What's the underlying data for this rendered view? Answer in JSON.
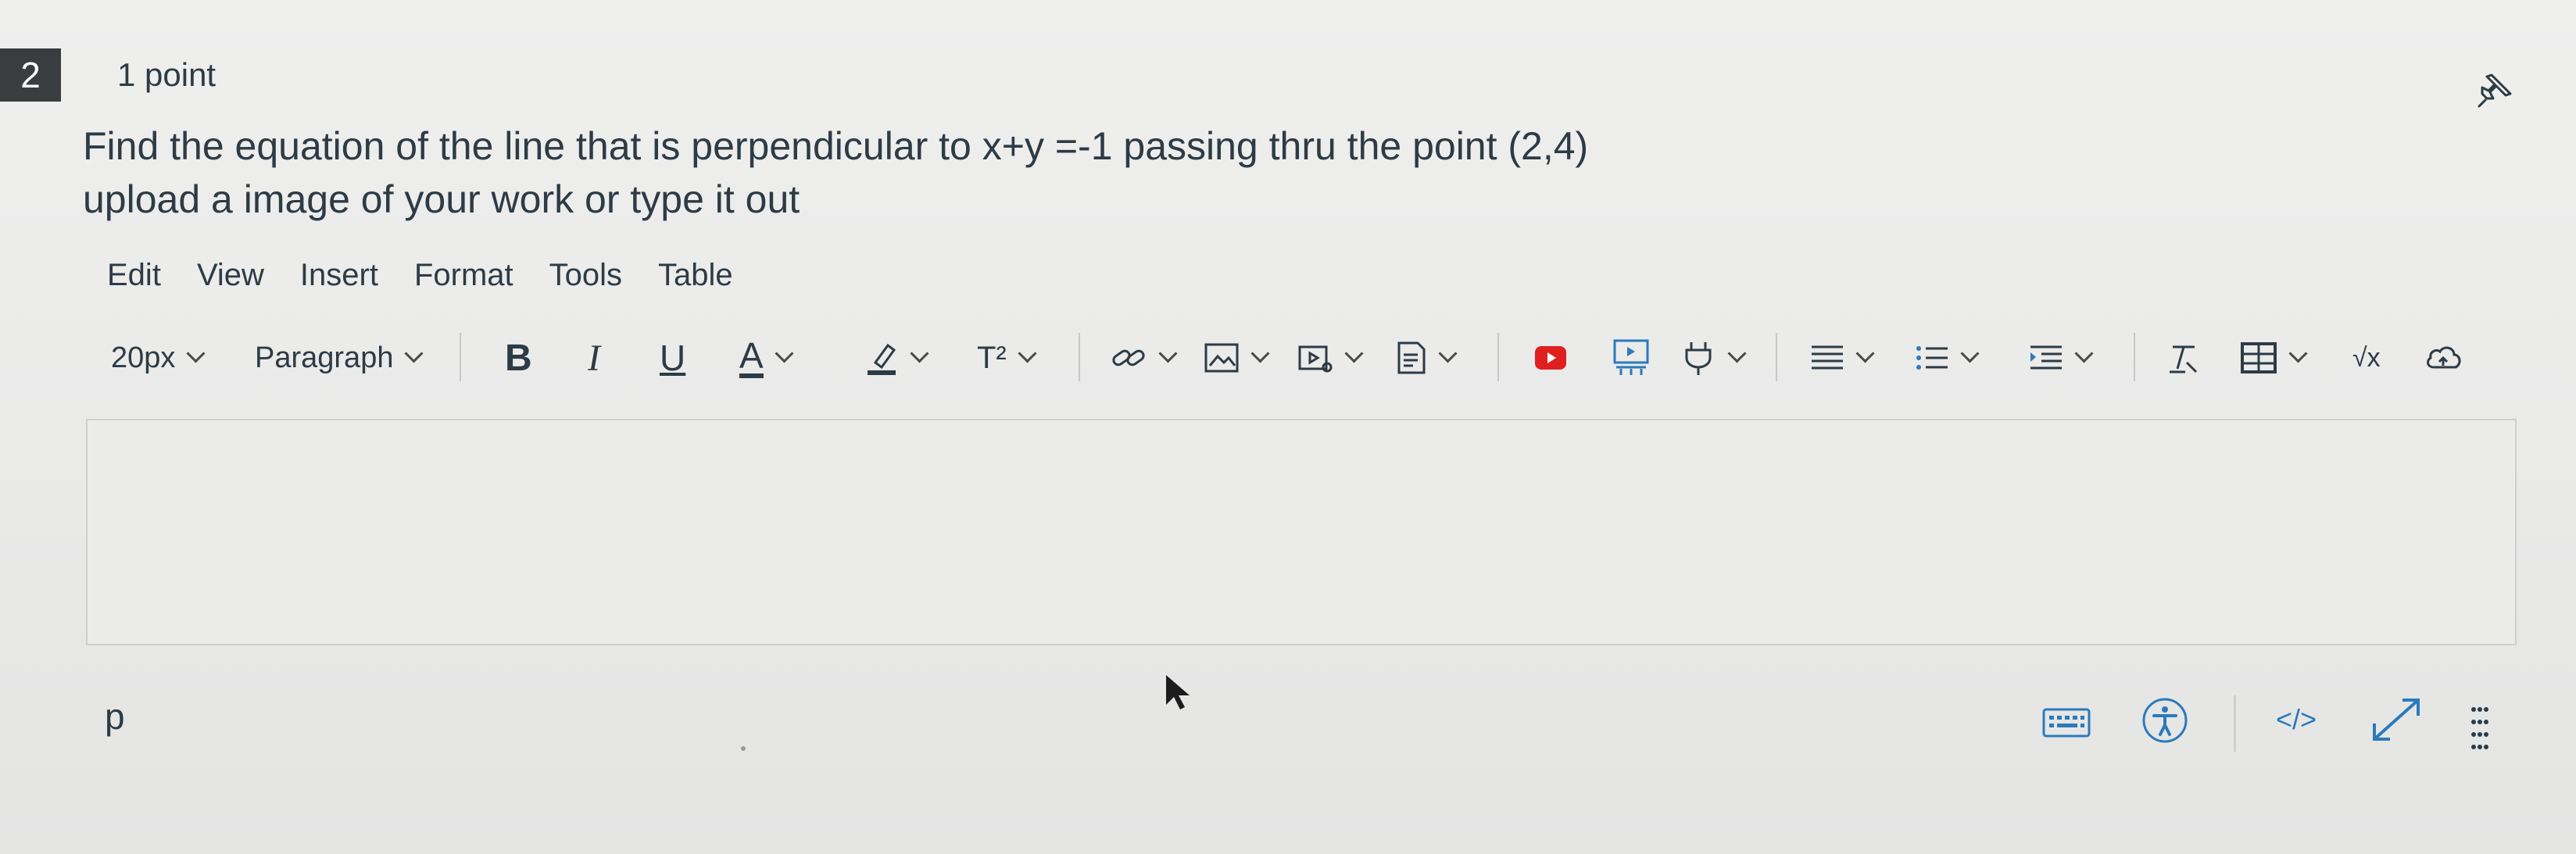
{
  "question": {
    "number": "2",
    "points": "1 point",
    "line1": "Find the equation of the line that is perpendicular to x+y =-1 passing thru the point (2,4)",
    "line2": "upload a image of your work or type it out"
  },
  "menubar": {
    "edit": "Edit",
    "view": "View",
    "insert": "Insert",
    "format": "Format",
    "tools": "Tools",
    "table": "Table"
  },
  "toolbar": {
    "font_size": "20px",
    "block_format": "Paragraph",
    "bold": "B",
    "italic": "I",
    "underline": "U",
    "text_color": "A",
    "superscript": "T²",
    "equation": "√x"
  },
  "status": {
    "path": "p",
    "html_editor": "</>"
  },
  "icons": {
    "pin": "pin-icon",
    "link": "link-icon",
    "image": "image-icon",
    "media": "media-icon",
    "document": "document-icon",
    "youtube": "youtube-icon",
    "present": "presentation-icon",
    "plugin": "plugin-icon",
    "align": "align-icon",
    "list": "list-icon",
    "indent": "indent-icon",
    "clear_format": "clear-format-icon",
    "table": "table-icon",
    "cloud": "cloud-icon",
    "keyboard": "keyboard-icon",
    "accessibility": "accessibility-icon",
    "fullscreen": "fullscreen-icon",
    "drag": "drag-handle-icon"
  },
  "colors": {
    "badge_bg": "#3a3d40",
    "text": "#2d3b45",
    "youtube_red": "#e0201f",
    "accent_blue": "#2b7abc"
  }
}
